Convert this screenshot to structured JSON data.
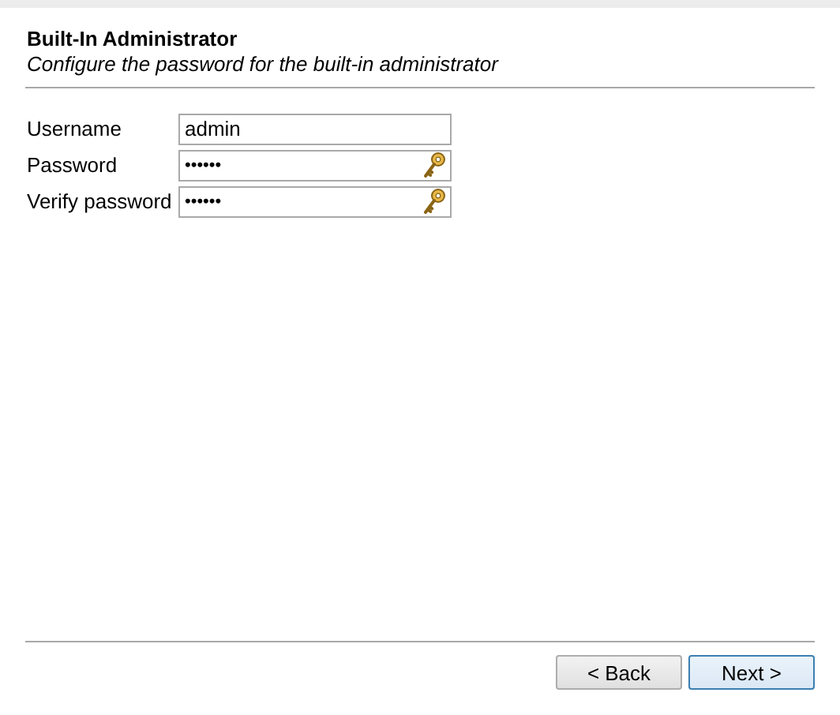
{
  "header": {
    "title": "Built-In Administrator",
    "subtitle": "Configure the password for the built-in administrator"
  },
  "fields": [
    {
      "label": "Username",
      "value": "admin",
      "kind": "text"
    },
    {
      "label": "Password",
      "value": "••••••",
      "kind": "password"
    },
    {
      "label": "Verify password",
      "value": "••••••",
      "kind": "password"
    }
  ],
  "buttons": [
    {
      "label": "< Back",
      "default": false
    },
    {
      "label": "Next >",
      "default": true
    }
  ]
}
